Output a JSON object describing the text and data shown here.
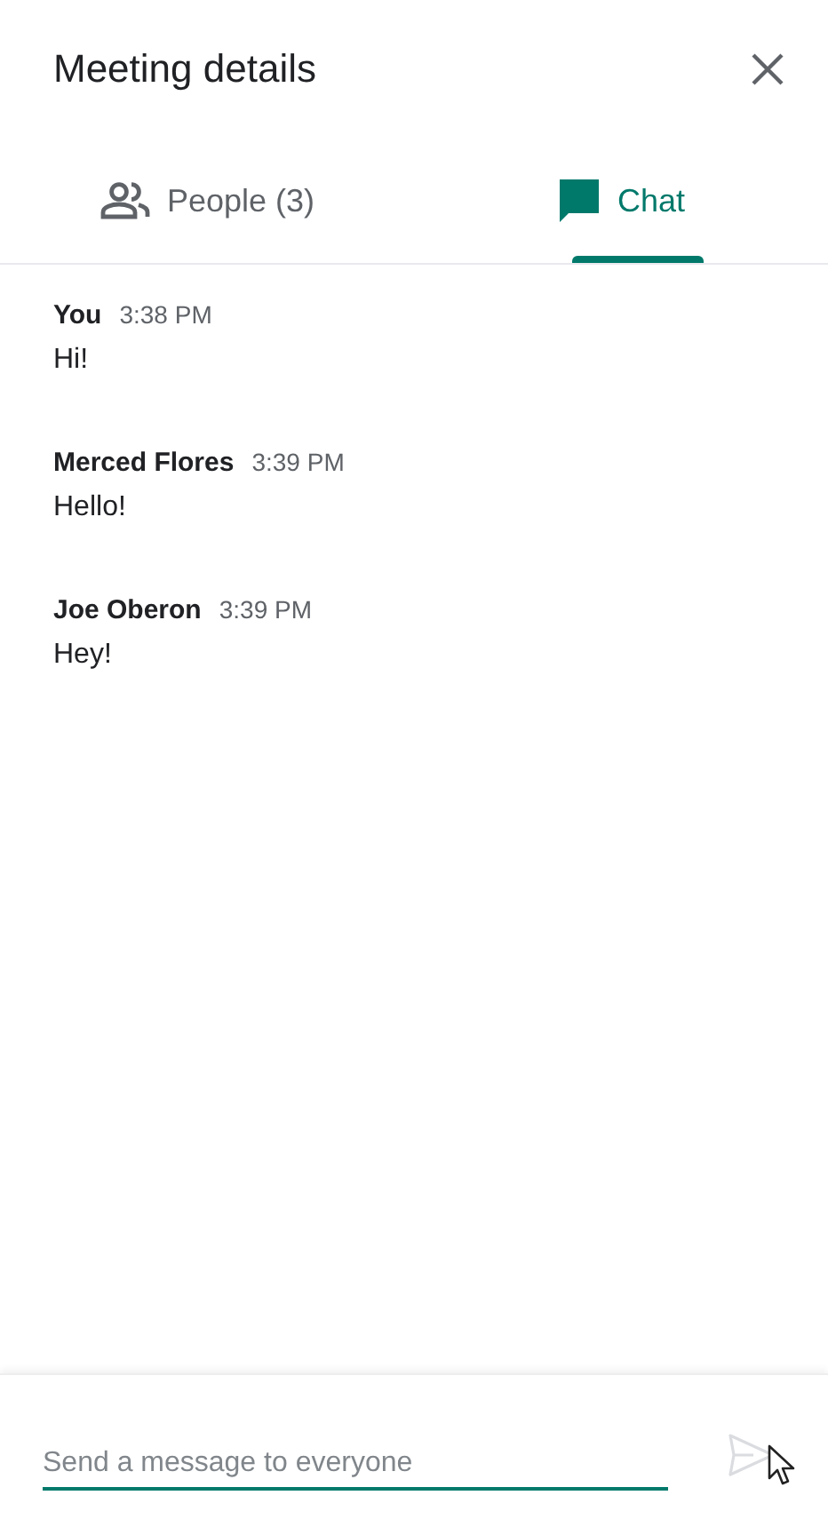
{
  "header": {
    "title": "Meeting details"
  },
  "tabs": [
    {
      "kind": "people",
      "label": "People (3)",
      "selected": false
    },
    {
      "kind": "chat",
      "label": "Chat",
      "selected": true
    }
  ],
  "messages": [
    {
      "sender": "You",
      "time": "3:38 PM",
      "text": "Hi!"
    },
    {
      "sender": "Merced Flores",
      "time": "3:39 PM",
      "text": "Hello!"
    },
    {
      "sender": "Joe Oberon",
      "time": "3:39 PM",
      "text": "Hey!"
    }
  ],
  "composer": {
    "placeholder": "Send a message to everyone",
    "send_disabled": true
  }
}
